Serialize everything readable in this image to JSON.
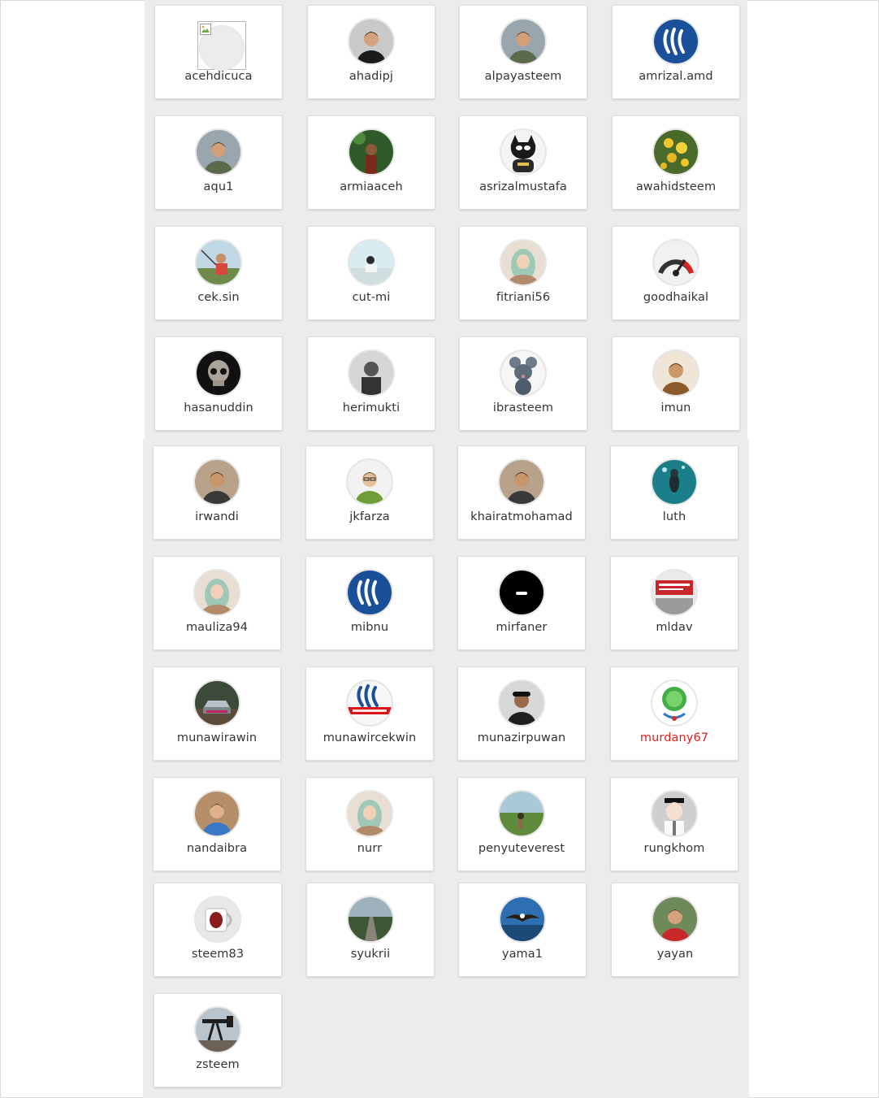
{
  "users": [
    {
      "name": "acehdicuca",
      "broken_image": true
    },
    {
      "name": "ahadipj",
      "avatar": "man-photo-icon"
    },
    {
      "name": "alpayasteem",
      "avatar": "person-outdoors-icon"
    },
    {
      "name": "amrizal.amd",
      "avatar": "steem-logo-icon"
    },
    {
      "name": "aqu1",
      "avatar": "person-outdoors-icon"
    },
    {
      "name": "armiaaceh",
      "avatar": "person-in-forest-icon"
    },
    {
      "name": "asrizalmustafa",
      "avatar": "cartoon-batman-icon"
    },
    {
      "name": "awahidsteem",
      "avatar": "yellow-flowers-icon"
    },
    {
      "name": "cek.sin",
      "avatar": "person-fishing-icon"
    },
    {
      "name": "cut-mi",
      "avatar": "child-on-beach-icon"
    },
    {
      "name": "fitriani56",
      "avatar": "woman-hijab-icon"
    },
    {
      "name": "goodhaikal",
      "avatar": "gauge-icon"
    },
    {
      "name": "hasanuddin",
      "avatar": "skull-icon"
    },
    {
      "name": "herimukti",
      "avatar": "bw-portrait-icon"
    },
    {
      "name": "ibrasteem",
      "avatar": "cartoon-rat-icon"
    },
    {
      "name": "imun",
      "avatar": "person-sitting-icon"
    },
    {
      "name": "irwandi",
      "avatar": "man-portrait-icon"
    },
    {
      "name": "jkfarza",
      "avatar": "man-glasses-icon"
    },
    {
      "name": "khairatmohamad",
      "avatar": "man-portrait-icon"
    },
    {
      "name": "luth",
      "avatar": "diver-underwater-icon"
    },
    {
      "name": "mauliza94",
      "avatar": "woman-hijab-icon"
    },
    {
      "name": "mibnu",
      "avatar": "steem-logo-icon"
    },
    {
      "name": "mirfaner",
      "avatar": "black-circle-icon"
    },
    {
      "name": "mldav",
      "avatar": "banner-photo-icon"
    },
    {
      "name": "munawirawin",
      "avatar": "car-photo-icon"
    },
    {
      "name": "munawircekwin",
      "avatar": "steem-red-banner-icon"
    },
    {
      "name": "munazirpuwan",
      "avatar": "man-cap-icon"
    },
    {
      "name": "murdany67",
      "avatar": "green-emblem-icon",
      "highlight": true
    },
    {
      "name": "nandaibra",
      "avatar": "person-blue-icon"
    },
    {
      "name": "nurr",
      "avatar": "woman-hijab-icon"
    },
    {
      "name": "penyuteverest",
      "avatar": "landscape-icon"
    },
    {
      "name": "rungkhom",
      "avatar": "anime-boy-icon"
    },
    {
      "name": "steem83",
      "avatar": "coffee-cup-icon"
    },
    {
      "name": "syukrii",
      "avatar": "road-landscape-icon"
    },
    {
      "name": "yama1",
      "avatar": "eagle-icon"
    },
    {
      "name": "yayan",
      "avatar": "person-red-shirt-icon"
    },
    {
      "name": "zsteem",
      "avatar": "oil-pump-icon"
    }
  ],
  "colors": {
    "panel_bg": "#ececec",
    "card_bg": "#ffffff",
    "text": "#333333",
    "highlight_text": "#e0211d"
  }
}
